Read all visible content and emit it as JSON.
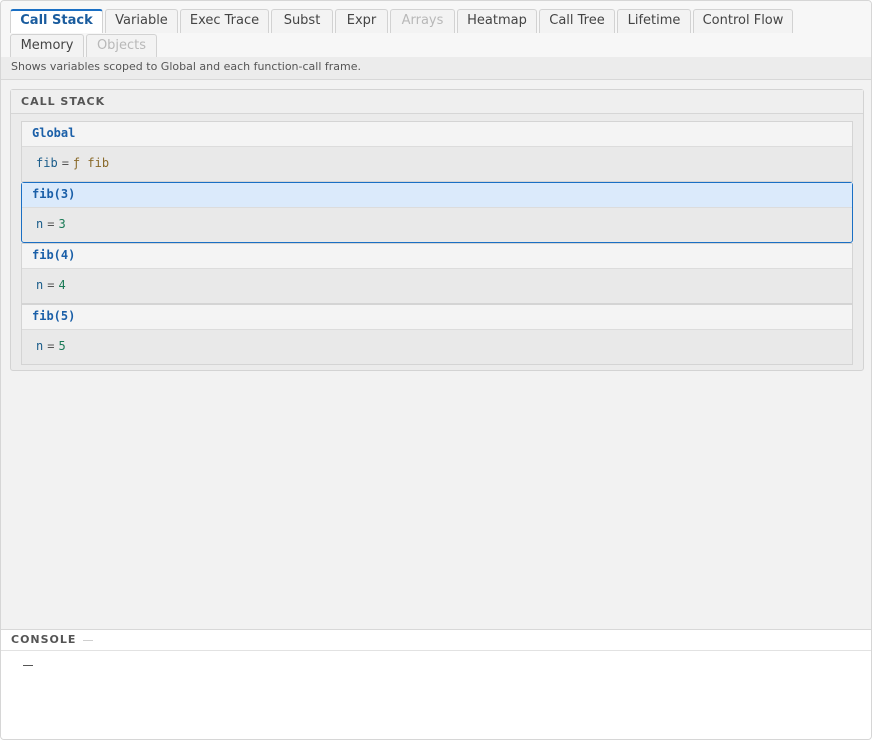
{
  "tabs": [
    {
      "label": "Call Stack",
      "state": "active"
    },
    {
      "label": "Variable",
      "state": "normal"
    },
    {
      "label": "Exec Trace",
      "state": "normal"
    },
    {
      "label": "Subst",
      "state": "normal"
    },
    {
      "label": "Expr",
      "state": "normal"
    },
    {
      "label": "Arrays",
      "state": "disabled"
    },
    {
      "label": "Heatmap",
      "state": "normal"
    },
    {
      "label": "Call Tree",
      "state": "normal"
    },
    {
      "label": "Lifetime",
      "state": "normal"
    },
    {
      "label": "Control Flow",
      "state": "normal"
    },
    {
      "label": "Memory",
      "state": "normal"
    },
    {
      "label": "Objects",
      "state": "disabled"
    }
  ],
  "description": "Shows variables scoped to Global and each function-call frame.",
  "call_stack": {
    "title": "CALL STACK",
    "frames": [
      {
        "name": "Global",
        "active": false,
        "vars": [
          {
            "name": "fib",
            "eq": "=",
            "value": "ƒ fib",
            "kind": "function"
          }
        ]
      },
      {
        "name": "fib(3)",
        "active": true,
        "vars": [
          {
            "name": "n",
            "eq": "=",
            "value": "3",
            "kind": "number"
          }
        ]
      },
      {
        "name": "fib(4)",
        "active": false,
        "vars": [
          {
            "name": "n",
            "eq": "=",
            "value": "4",
            "kind": "number"
          }
        ]
      },
      {
        "name": "fib(5)",
        "active": false,
        "vars": [
          {
            "name": "n",
            "eq": "=",
            "value": "5",
            "kind": "number"
          }
        ]
      }
    ]
  },
  "console": {
    "title": "CONSOLE"
  },
  "colors": {
    "accent": "#1a6fc4",
    "frame_name": "#1a5fa8",
    "number_value": "#1a7a56",
    "function_value": "#8a6a2a"
  }
}
